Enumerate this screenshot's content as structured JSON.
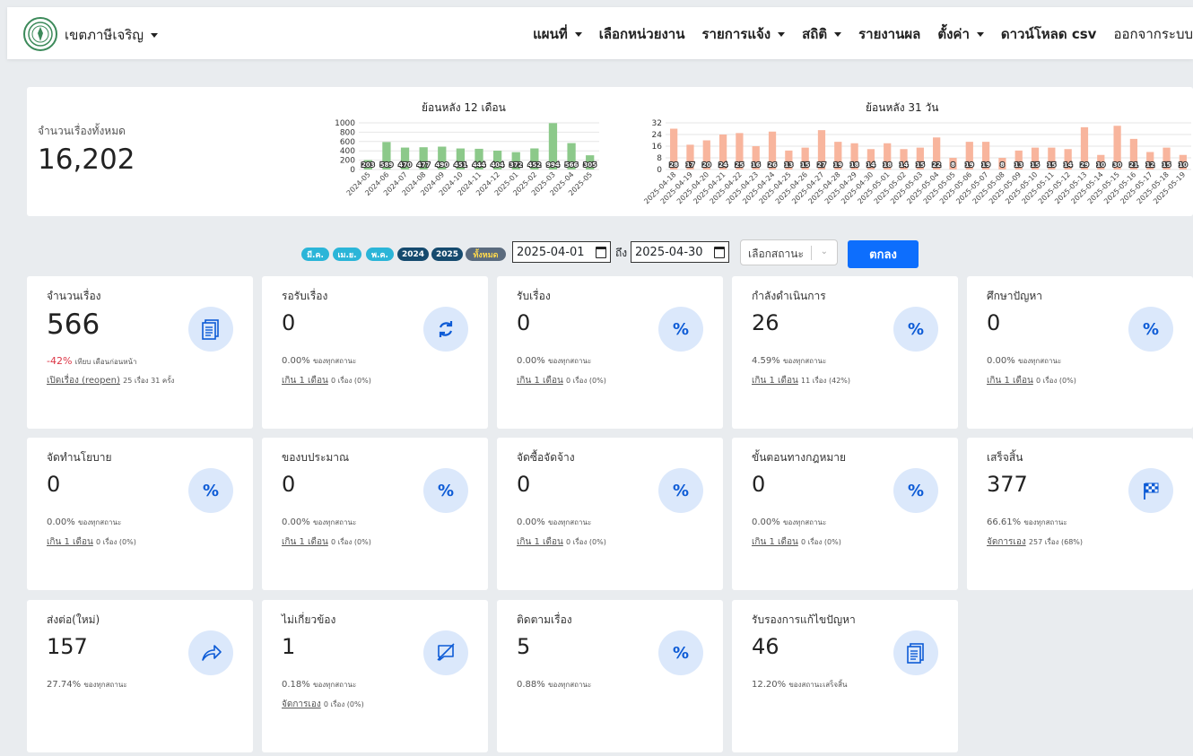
{
  "nav": {
    "district": "เขตภาษีเจริญ",
    "items": [
      {
        "label": "แผนที่",
        "dropdown": true
      },
      {
        "label": "เลือกหน่วยงาน",
        "dropdown": false
      },
      {
        "label": "รายการแจ้ง",
        "dropdown": true
      },
      {
        "label": "สถิติ",
        "dropdown": true
      },
      {
        "label": "รายงานผล",
        "dropdown": false
      },
      {
        "label": "ตั้งค่า",
        "dropdown": true
      },
      {
        "label": "ดาวน์โหลด csv",
        "dropdown": false
      }
    ],
    "logout": "ออกจากระบบ"
  },
  "summary": {
    "label": "จำนวนเรื่องทั้งหมด",
    "value": "16,202"
  },
  "chart_data": [
    {
      "type": "bar",
      "title": "ย้อนหลัง 12 เดือน",
      "categories": [
        "2024-05",
        "2024-06",
        "2024-07",
        "2024-08",
        "2024-09",
        "2024-10",
        "2024-11",
        "2024-12",
        "2025-01",
        "2025-02",
        "2025-03",
        "2025-04",
        "2025-05"
      ],
      "values": [
        203,
        589,
        470,
        477,
        490,
        451,
        444,
        404,
        372,
        452,
        994,
        566,
        305
      ],
      "yticks": [
        0,
        200,
        400,
        600,
        800,
        1000
      ],
      "ylim": [
        0,
        1000
      ],
      "color": "#8cc98a",
      "grid": true
    },
    {
      "type": "bar",
      "title": "ย้อนหลัง 31 วัน",
      "categories": [
        "2025-04-18",
        "2025-04-19",
        "2025-04-20",
        "2025-04-21",
        "2025-04-22",
        "2025-04-23",
        "2025-04-24",
        "2025-04-25",
        "2025-04-26",
        "2025-04-27",
        "2025-04-28",
        "2025-04-29",
        "2025-04-30",
        "2025-05-01",
        "2025-05-02",
        "2025-05-03",
        "2025-05-04",
        "2025-05-05",
        "2025-05-06",
        "2025-05-07",
        "2025-05-08",
        "2025-05-09",
        "2025-05-10",
        "2025-05-11",
        "2025-05-12",
        "2025-05-13",
        "2025-05-14",
        "2025-05-15",
        "2025-05-16",
        "2025-05-17",
        "2025-05-18",
        "2025-05-19"
      ],
      "values": [
        28,
        17,
        20,
        24,
        25,
        16,
        26,
        13,
        15,
        27,
        19,
        18,
        14,
        18,
        14,
        15,
        22,
        8,
        19,
        19,
        8,
        13,
        15,
        15,
        14,
        29,
        10,
        30,
        21,
        12,
        15,
        10
      ],
      "yticks": [
        0,
        8,
        16,
        24,
        32
      ],
      "ylim": [
        0,
        32
      ],
      "color": "#f8b59d",
      "grid": true
    }
  ],
  "filters": {
    "pills": [
      {
        "label": "มี.ค.",
        "style": "light"
      },
      {
        "label": "เม.ย.",
        "style": "light"
      },
      {
        "label": "พ.ค.",
        "style": "light"
      },
      {
        "label": "2024",
        "style": "dark"
      },
      {
        "label": "2025",
        "style": "dark"
      },
      {
        "label": "ทั้งหมด",
        "style": "gray"
      }
    ],
    "date_from": "2025-04-01",
    "to_label": "ถึง",
    "date_to": "2025-04-30",
    "status_placeholder": "เลือกสถานะ",
    "ok_label": "ตกลง"
  },
  "cards": [
    {
      "title": "จำนวนเรื่อง",
      "value": "566",
      "big": true,
      "icon": "documents-icon",
      "pct_neg": "-42%",
      "pct_text": "เทียบ เดือนก่อนหน้า",
      "extra_link": "เปิดเรื่อง (reopen)",
      "extra_text": "25 เรื่อง 31 ครั้ง"
    },
    {
      "title": "รอรับเรื่อง",
      "value": "0",
      "icon": "refresh-icon",
      "pct": "0.00%",
      "pct_text": "ของทุกสถานะ",
      "extra_link": "เกิน 1 เดือน",
      "extra_text": "0 เรื่อง (0%)"
    },
    {
      "title": "รับเรื่อง",
      "value": "0",
      "icon": "percent-icon",
      "pct": "0.00%",
      "pct_text": "ของทุกสถานะ",
      "extra_link": "เกิน 1 เดือน",
      "extra_text": "0 เรื่อง (0%)"
    },
    {
      "title": "กำลังดำเนินการ",
      "value": "26",
      "icon": "percent-icon",
      "pct": "4.59%",
      "pct_text": "ของทุกสถานะ",
      "extra_link": "เกิน 1 เดือน",
      "extra_text": "11 เรื่อง (42%)"
    },
    {
      "title": "ศึกษาปัญหา",
      "value": "0",
      "icon": "percent-icon",
      "pct": "0.00%",
      "pct_text": "ของทุกสถานะ",
      "extra_link": "เกิน 1 เดือน",
      "extra_text": "0 เรื่อง (0%)"
    },
    {
      "title": "จัดทำนโยบาย",
      "value": "0",
      "icon": "percent-icon",
      "pct": "0.00%",
      "pct_text": "ของทุกสถานะ",
      "extra_link": "เกิน 1 เดือน",
      "extra_text": "0 เรื่อง (0%)"
    },
    {
      "title": "ของบประมาณ",
      "value": "0",
      "icon": "percent-icon",
      "pct": "0.00%",
      "pct_text": "ของทุกสถานะ",
      "extra_link": "เกิน 1 เดือน",
      "extra_text": "0 เรื่อง (0%)"
    },
    {
      "title": "จัดซื้อจัดจ้าง",
      "value": "0",
      "icon": "percent-icon",
      "pct": "0.00%",
      "pct_text": "ของทุกสถานะ",
      "extra_link": "เกิน 1 เดือน",
      "extra_text": "0 เรื่อง (0%)"
    },
    {
      "title": "ขั้นตอนทางกฎหมาย",
      "value": "0",
      "icon": "percent-icon",
      "pct": "0.00%",
      "pct_text": "ของทุกสถานะ",
      "extra_link": "เกิน 1 เดือน",
      "extra_text": "0 เรื่อง (0%)"
    },
    {
      "title": "เสร็จสิ้น",
      "value": "377",
      "icon": "checkered-flag-icon",
      "pct": "66.61%",
      "pct_text": "ของทุกสถานะ",
      "extra_link": "จัดการเอง",
      "extra_text": "257 เรื่อง (68%)"
    },
    {
      "title": "ส่งต่อ(ใหม่)",
      "value": "157",
      "icon": "share-arrow-icon",
      "pct": "27.74%",
      "pct_text": "ของทุกสถานะ",
      "extra_link": "",
      "extra_text": ""
    },
    {
      "title": "ไม่เกี่ยวข้อง",
      "value": "1",
      "icon": "chat-slash-icon",
      "pct": "0.18%",
      "pct_text": "ของทุกสถานะ",
      "extra_link": "จัดการเอง",
      "extra_text": "0 เรื่อง (0%)"
    },
    {
      "title": "ติดตามเรื่อง",
      "value": "5",
      "icon": "percent-icon",
      "pct": "0.88%",
      "pct_text": "ของทุกสถานะ",
      "extra_link": "",
      "extra_text": ""
    },
    {
      "title": "รับรองการแก้ไขปัญหา",
      "value": "46",
      "icon": "documents-icon",
      "pct": "12.20%",
      "pct_text": "ของสถานะเสร็จสิ้น",
      "extra_link": "",
      "extra_text": ""
    }
  ]
}
